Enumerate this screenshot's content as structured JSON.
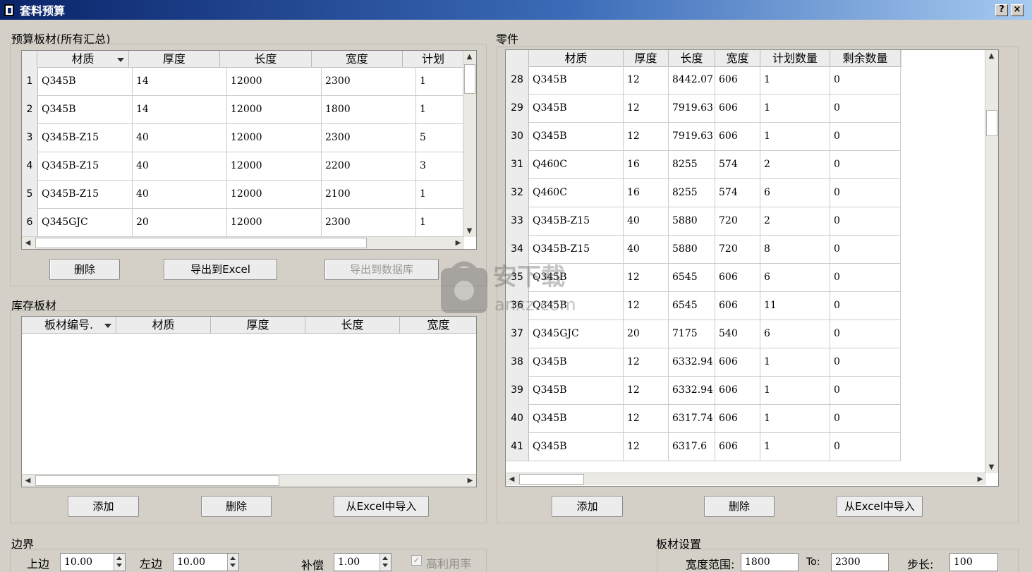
{
  "window": {
    "title": "套料预算",
    "help": "?",
    "close": "×"
  },
  "budget": {
    "title": "预算板材(所有汇总)",
    "columns": [
      "材质",
      "厚度",
      "长度",
      "宽度",
      "计划"
    ],
    "rows": [
      {
        "n": "1",
        "cells": [
          "Q345B",
          "14",
          "12000",
          "2300",
          "1"
        ]
      },
      {
        "n": "2",
        "cells": [
          "Q345B",
          "14",
          "12000",
          "1800",
          "1"
        ]
      },
      {
        "n": "3",
        "cells": [
          "Q345B-Z15",
          "40",
          "12000",
          "2300",
          "5"
        ]
      },
      {
        "n": "4",
        "cells": [
          "Q345B-Z15",
          "40",
          "12000",
          "2200",
          "3"
        ]
      },
      {
        "n": "5",
        "cells": [
          "Q345B-Z15",
          "40",
          "12000",
          "2100",
          "1"
        ]
      },
      {
        "n": "6",
        "cells": [
          "Q345GJC",
          "20",
          "12000",
          "2300",
          "1"
        ]
      }
    ],
    "buttons": {
      "delete": "删除",
      "export_excel": "导出到Excel",
      "export_db": "导出到数据库"
    }
  },
  "stock": {
    "title": "库存板材",
    "columns": [
      "板材编号.",
      "材质",
      "厚度",
      "长度",
      "宽度"
    ],
    "buttons": {
      "add": "添加",
      "delete": "删除",
      "import": "从Excel中导入"
    }
  },
  "parts": {
    "title": "零件",
    "columns": [
      "材质",
      "厚度",
      "长度",
      "宽度",
      "计划数量",
      "剩余数量"
    ],
    "rows": [
      {
        "n": "28",
        "cells": [
          "Q345B",
          "12",
          "8442.07",
          "606",
          "1",
          "0"
        ]
      },
      {
        "n": "29",
        "cells": [
          "Q345B",
          "12",
          "7919.63",
          "606",
          "1",
          "0"
        ]
      },
      {
        "n": "30",
        "cells": [
          "Q345B",
          "12",
          "7919.63",
          "606",
          "1",
          "0"
        ]
      },
      {
        "n": "31",
        "cells": [
          "Q460C",
          "16",
          "8255",
          "574",
          "2",
          "0"
        ]
      },
      {
        "n": "32",
        "cells": [
          "Q460C",
          "16",
          "8255",
          "574",
          "6",
          "0"
        ]
      },
      {
        "n": "33",
        "cells": [
          "Q345B-Z15",
          "40",
          "5880",
          "720",
          "2",
          "0"
        ]
      },
      {
        "n": "34",
        "cells": [
          "Q345B-Z15",
          "40",
          "5880",
          "720",
          "8",
          "0"
        ]
      },
      {
        "n": "35",
        "cells": [
          "Q345B",
          "12",
          "6545",
          "606",
          "6",
          "0"
        ]
      },
      {
        "n": "36",
        "cells": [
          "Q345B",
          "12",
          "6545",
          "606",
          "11",
          "0"
        ]
      },
      {
        "n": "37",
        "cells": [
          "Q345GJC",
          "20",
          "7175",
          "540",
          "6",
          "0"
        ]
      },
      {
        "n": "38",
        "cells": [
          "Q345B",
          "12",
          "6332.94",
          "606",
          "1",
          "0"
        ]
      },
      {
        "n": "39",
        "cells": [
          "Q345B",
          "12",
          "6332.94",
          "606",
          "1",
          "0"
        ]
      },
      {
        "n": "40",
        "cells": [
          "Q345B",
          "12",
          "6317.74",
          "606",
          "1",
          "0"
        ]
      },
      {
        "n": "41",
        "cells": [
          "Q345B",
          "12",
          "6317.6",
          "606",
          "1",
          "0"
        ]
      }
    ],
    "buttons": {
      "add": "添加",
      "delete": "删除",
      "import": "从Excel中导入"
    }
  },
  "border": {
    "title": "边界",
    "top_label": "上边",
    "top_value": "10.00",
    "left_label": "左边",
    "left_value": "10.00",
    "comp_label": "补偿",
    "comp_value": "1.00",
    "high_util_label": "高利用率",
    "high_util_checked": true
  },
  "plate": {
    "title": "板材设置",
    "width_label": "宽度范围:",
    "width_from": "1800",
    "to_label": "To:",
    "width_to": "2300",
    "step_label": "步长:",
    "step_value": "100"
  },
  "watermark": {
    "text": "安下载",
    "sub": "anxz.com"
  }
}
